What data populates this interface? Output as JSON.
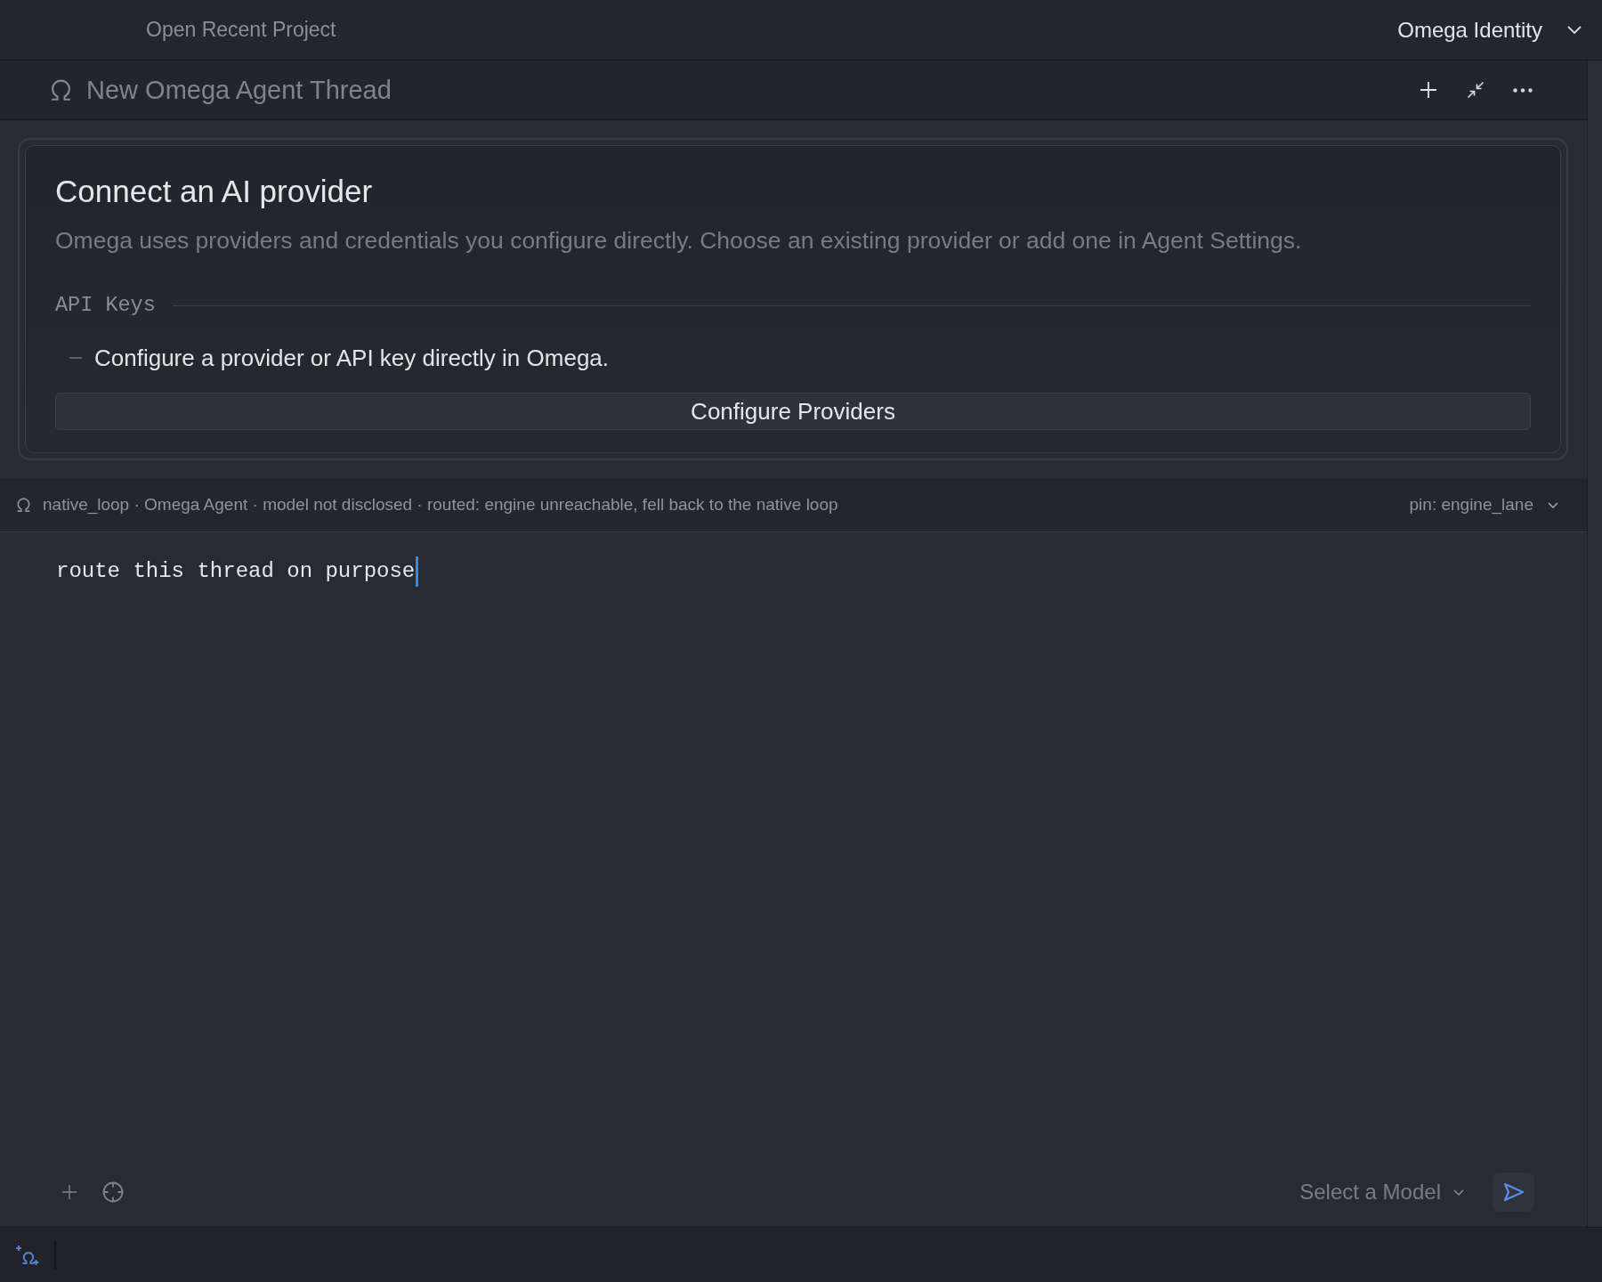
{
  "top_bar": {
    "project_menu": "Open Recent Project",
    "identity_menu": "Omega Identity"
  },
  "thread_header": {
    "title": "New Omega Agent Thread"
  },
  "provider_card": {
    "title": "Connect an AI provider",
    "description": "Omega uses providers and credentials you configure directly. Choose an existing provider or add one in Agent Settings.",
    "section_label": "API Keys",
    "items": [
      "Configure a provider or API key directly in Omega."
    ],
    "button": "Configure Providers"
  },
  "route_bar": {
    "info": "native_loop · Omega Agent · model not disclosed · routed: engine unreachable, fell back to the native loop",
    "pin_menu": "pin: engine_lane"
  },
  "editor": {
    "value": "route this thread on purpose",
    "focused": true
  },
  "composer": {
    "model_select": "Select a Model"
  }
}
